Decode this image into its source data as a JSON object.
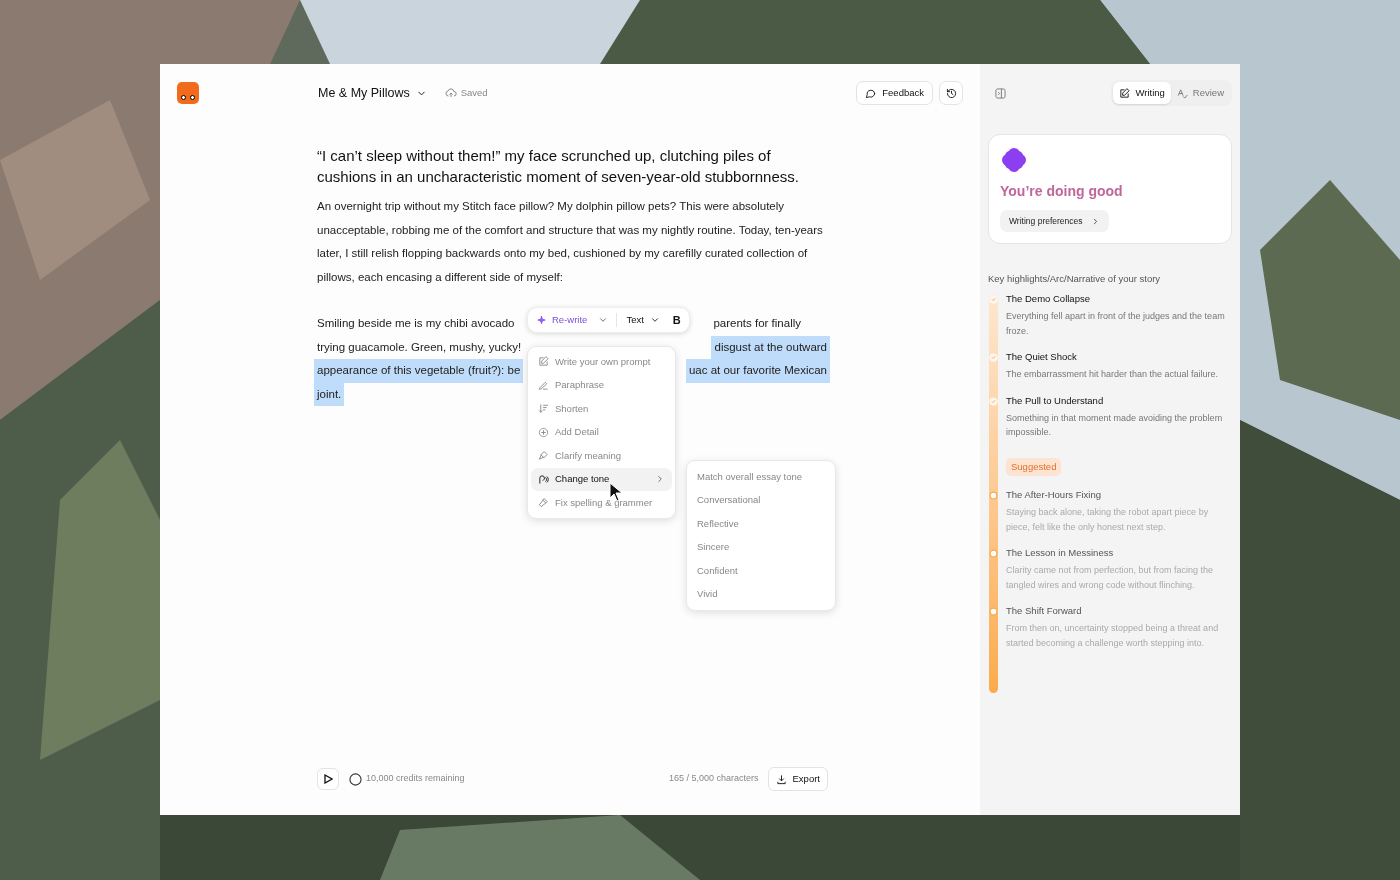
{
  "document": {
    "title": "Me & My Pillows",
    "save_status": "Saved"
  },
  "header_buttons": [
    {
      "kind": "feedback",
      "label": "Feedback"
    },
    {
      "kind": "history"
    }
  ],
  "essay": {
    "heading": "“I can’t sleep without them!” my face scrunched up, clutching piles of cushions in an uncharacteristic moment of seven-year-old stubbornness.",
    "paragraph": "An overnight trip without my Stitch face pillow? My dolphin pillow pets?  This were absolutely unacceptable, robbing me of the comfort and structure that was my nightly routine. Today, ten-years later, I still relish flopping backwards onto my bed, cushioned by my carefilly curated collection of pillows, each encasing a different side of myself:",
    "partial_lines": [
      {
        "left": {
          "text": "Smiling beside me is my chibi avocado",
          "highlighted": false
        },
        "right": {
          "text": "parents for finally",
          "highlighted": false
        }
      },
      {
        "left": {
          "text": "trying guacamole. Green, mushy, yucky!",
          "highlighted": false
        },
        "right": {
          "text": "disgust at the outward",
          "highlighted": true
        }
      },
      {
        "left": {
          "text": "appearance of this vegetable (fruit?): be",
          "highlighted": true
        },
        "right": {
          "text": "uac at our favorite Mexican",
          "highlighted": true
        }
      },
      {
        "left": {
          "text": "joint.",
          "highlighted": true
        }
      }
    ]
  },
  "format_toolbar": {
    "rewrite": "Re-write",
    "text_style": "Text",
    "bold": "B"
  },
  "rewrite_menu": [
    {
      "kind": "prompt",
      "label": "Write your own prompt",
      "selected": false
    },
    {
      "kind": "paraphrase",
      "label": "Paraphrase",
      "selected": false
    },
    {
      "kind": "shorten",
      "label": "Shorten",
      "selected": false
    },
    {
      "kind": "detail",
      "label": "Add Detail",
      "selected": false
    },
    {
      "kind": "clarify",
      "label": "Clarify meaning",
      "selected": false
    },
    {
      "kind": "tone",
      "label": "Change tone",
      "selected": true,
      "submenu": true
    },
    {
      "kind": "spelling",
      "label": "Fix spelling & grammer",
      "selected": false
    }
  ],
  "tone_submenu": [
    "Match overall essay tone",
    "Conversational",
    "Reflective",
    "Sincere",
    "Confident",
    "Vivid"
  ],
  "footer": {
    "credits": "10,000 credits remaining",
    "characters": "165 / 5,000 characters",
    "export": "Export"
  },
  "side_tabs": [
    {
      "kind": "writing",
      "label": "Writing",
      "selected": true
    },
    {
      "kind": "review",
      "label": "Review",
      "selected": false
    }
  ],
  "status_card": {
    "title": "You’re doing good",
    "button": "Writing preferences"
  },
  "arc": {
    "heading": "Key highlights/Arc/Narrative of your story",
    "items": [
      {
        "title": "The Demo Collapse",
        "text": "Everything fell apart in front of the judges and the team froze.",
        "done": true
      },
      {
        "title": "The Quiet Shock",
        "text": "The embarrassment hit harder than the actual failure.",
        "done": true
      },
      {
        "title": "The Pull to Understand",
        "text": "Something in that moment made avoiding the problem impossible.",
        "done": true,
        "badge": "Suggested"
      },
      {
        "title": "The After-Hours Fixing",
        "text": "Staying back alone, taking the robot apart piece by piece, felt like the only honest next step.",
        "done": false
      },
      {
        "title": "The Lesson in Messiness",
        "text": "Clarity came not from perfection, but from facing the tangled wires and wrong code without flinching.",
        "done": false
      },
      {
        "title": "The Shift Forward",
        "text": "From then on, uncertainty stopped being a threat and started becoming a challenge worth stepping into.",
        "done": false
      }
    ]
  }
}
